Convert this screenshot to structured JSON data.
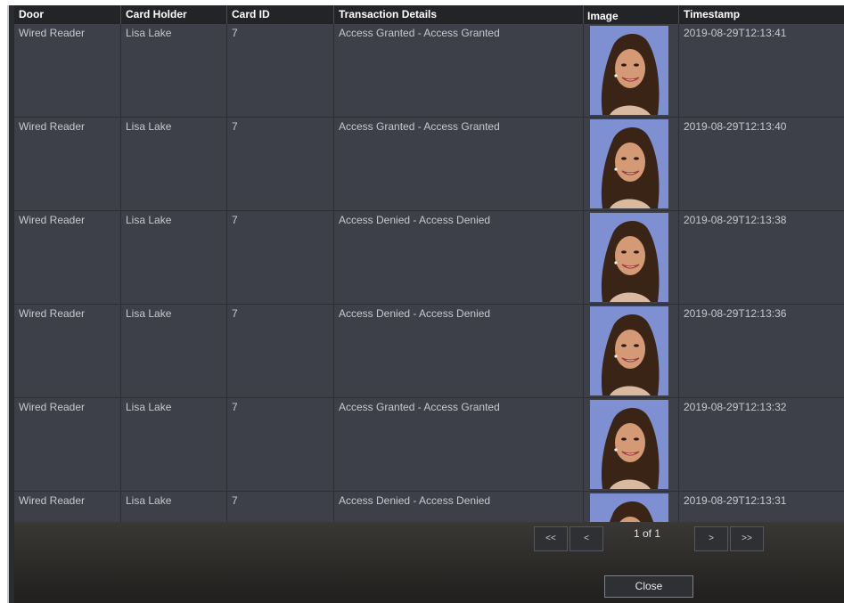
{
  "columns": {
    "door": "Door",
    "card_holder": "Card Holder",
    "card_id": "Card ID",
    "transaction_details": "Transaction Details",
    "image": "Image",
    "timestamp": "Timestamp"
  },
  "rows": [
    {
      "door": "Wired Reader",
      "card_holder": "Lisa Lake",
      "card_id": "7",
      "transaction_details": "Access Granted - Access Granted",
      "timestamp": "2019-08-29T12:13:41"
    },
    {
      "door": "Wired Reader",
      "card_holder": "Lisa Lake",
      "card_id": "7",
      "transaction_details": "Access Granted - Access Granted",
      "timestamp": "2019-08-29T12:13:40"
    },
    {
      "door": "Wired Reader",
      "card_holder": "Lisa Lake",
      "card_id": "7",
      "transaction_details": "Access Denied - Access Denied",
      "timestamp": "2019-08-29T12:13:38"
    },
    {
      "door": "Wired Reader",
      "card_holder": "Lisa Lake",
      "card_id": "7",
      "transaction_details": "Access Denied - Access Denied",
      "timestamp": "2019-08-29T12:13:36"
    },
    {
      "door": "Wired Reader",
      "card_holder": "Lisa Lake",
      "card_id": "7",
      "transaction_details": "Access Granted - Access Granted",
      "timestamp": "2019-08-29T12:13:32"
    },
    {
      "door": "Wired Reader",
      "card_holder": "Lisa Lake",
      "card_id": "7",
      "transaction_details": "Access Denied - Access Denied",
      "timestamp": "2019-08-29T12:13:31"
    }
  ],
  "pagination": {
    "first_label": "<<",
    "prev_label": "<",
    "current_page": "1",
    "of_label": "of",
    "total_pages": "1",
    "next_label": ">",
    "last_label": ">>"
  },
  "close_label": "Close",
  "colors": {
    "row_bg": "#3d4048",
    "header_bg": "#232428",
    "photo_bg": "#7e8fd0"
  }
}
